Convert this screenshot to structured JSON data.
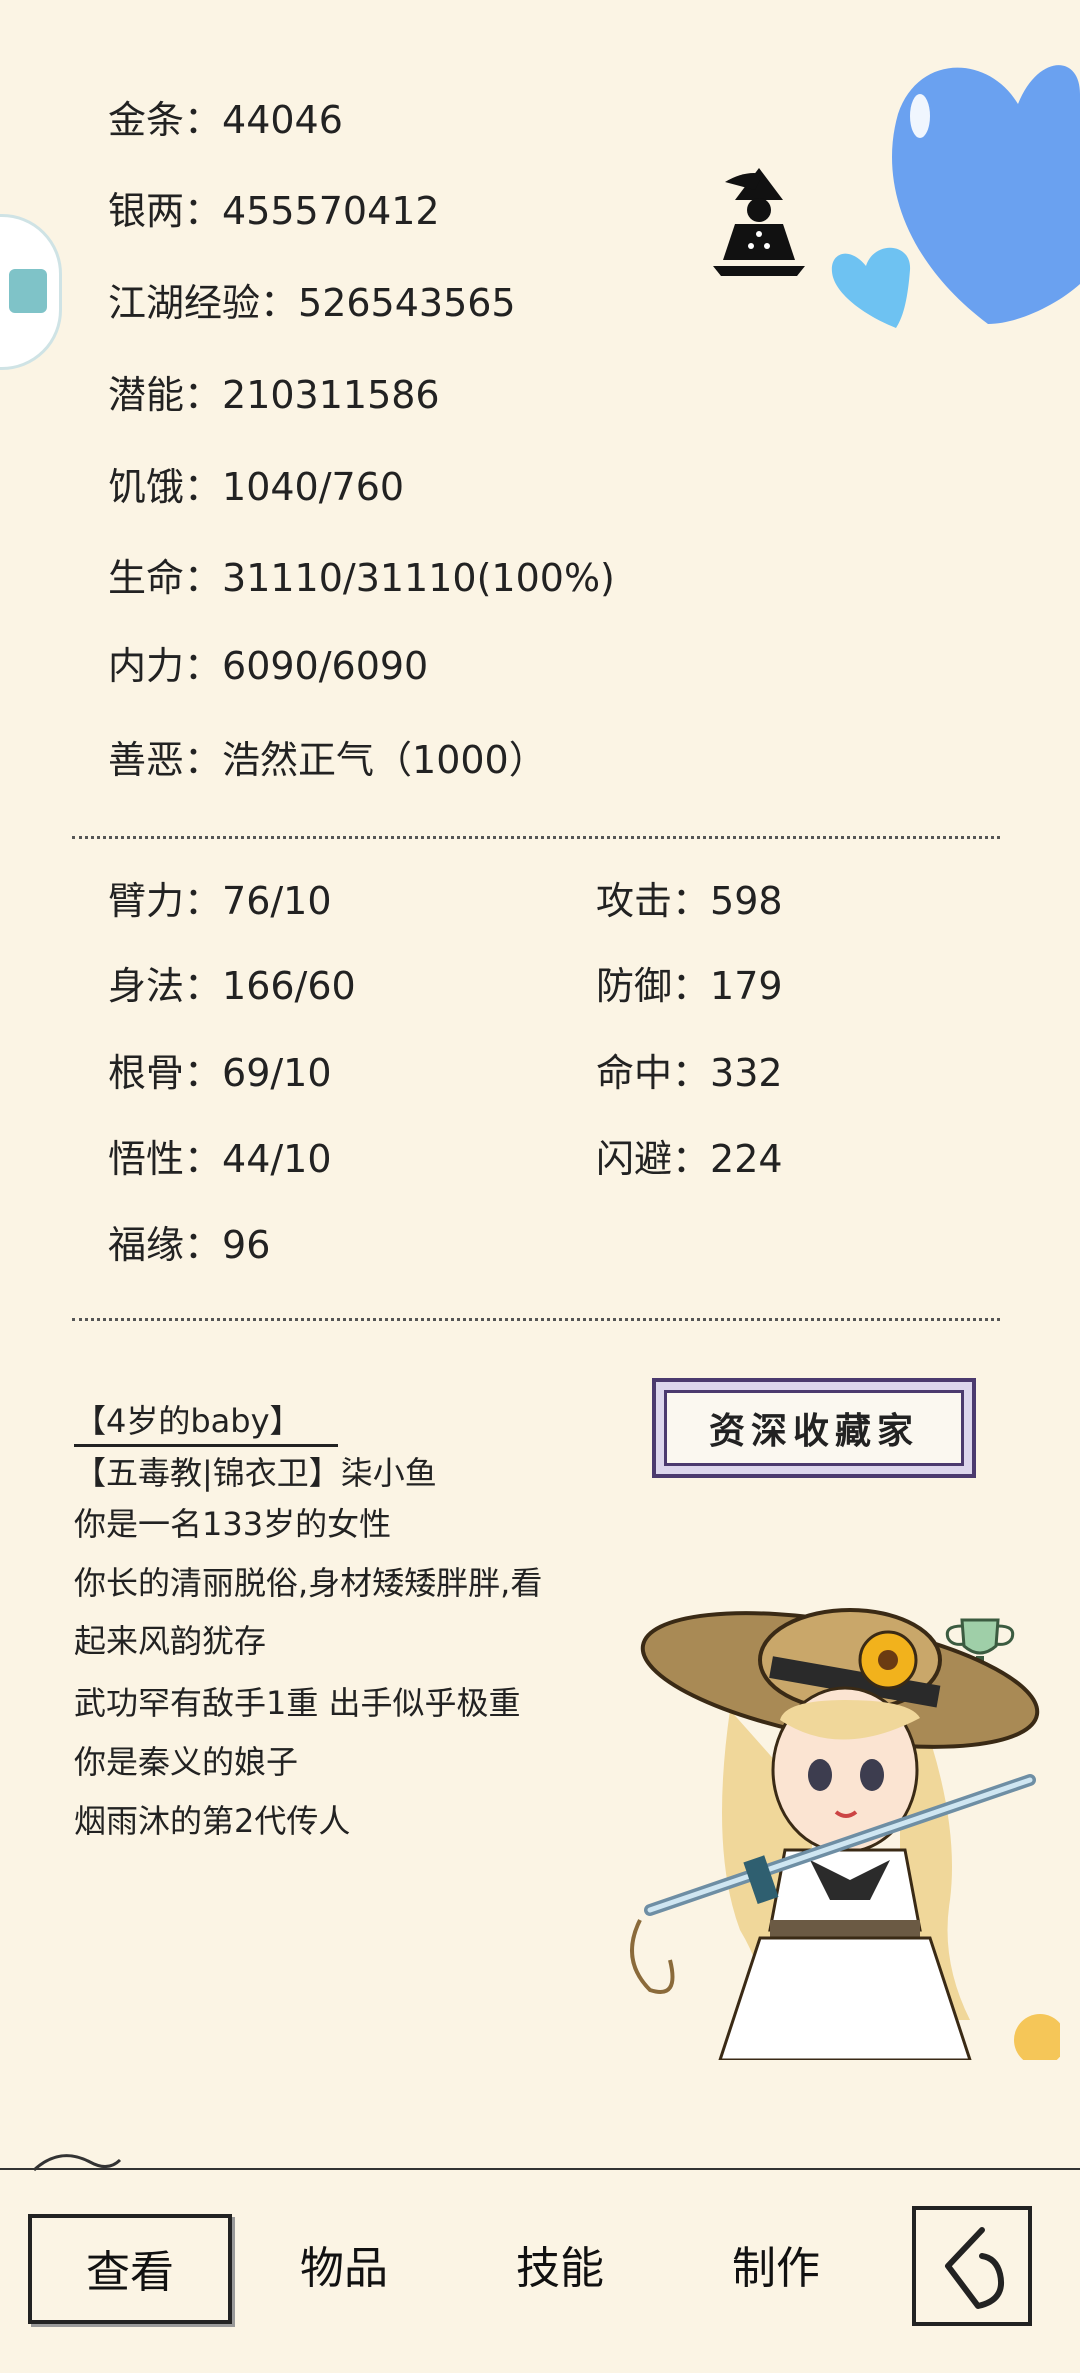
{
  "stats": [
    {
      "label": "金条：",
      "value": "44046"
    },
    {
      "label": "银两：",
      "value": "455570412"
    },
    {
      "label": "江湖经验：",
      "value": "526543565"
    },
    {
      "label": "潜能：",
      "value": "210311586"
    },
    {
      "label": "饥饿：",
      "value": "1040/760"
    },
    {
      "label": "生命：",
      "value": "31110/31110(100%)"
    },
    {
      "label": "内力：",
      "value": "6090/6090"
    },
    {
      "label": "善恶：",
      "value": "浩然正气（1000）"
    }
  ],
  "attributes_left": [
    {
      "label": "臂力：",
      "value": "76/10"
    },
    {
      "label": "身法：",
      "value": "166/60"
    },
    {
      "label": "根骨：",
      "value": "69/10"
    },
    {
      "label": "悟性：",
      "value": "44/10"
    },
    {
      "label": "福缘：",
      "value": "96"
    }
  ],
  "attributes_right": [
    {
      "label": "攻击：",
      "value": "598"
    },
    {
      "label": "防御：",
      "value": "179"
    },
    {
      "label": "命中：",
      "value": "332"
    },
    {
      "label": "闪避：",
      "value": "224"
    }
  ],
  "bio": {
    "title": "【4岁的baby】",
    "lines": [
      "【五毒教|锦衣卫】柒小鱼",
      "你是一名133岁的女性",
      "你长的清丽脱俗,身材矮矮胖胖,看",
      "起来风韵犹存",
      "武功罕有敌手1重 出手似乎极重",
      "你是秦义的娘子",
      "烟雨沐的第2代传人"
    ]
  },
  "badge": {
    "text": "资深收藏家"
  },
  "bottom_nav": {
    "tabs": [
      "查看",
      "物品",
      "技能",
      "制作"
    ],
    "active": "查看"
  },
  "icons": {
    "back": "back-arrow-icon",
    "trophy": "trophy-icon",
    "heart": "heart-icon",
    "meditation": "meditation-icon"
  },
  "colors": {
    "background": "#fbf4e4",
    "heart_blue": "#6aa1f0",
    "badge_border": "#4b3a6e"
  }
}
